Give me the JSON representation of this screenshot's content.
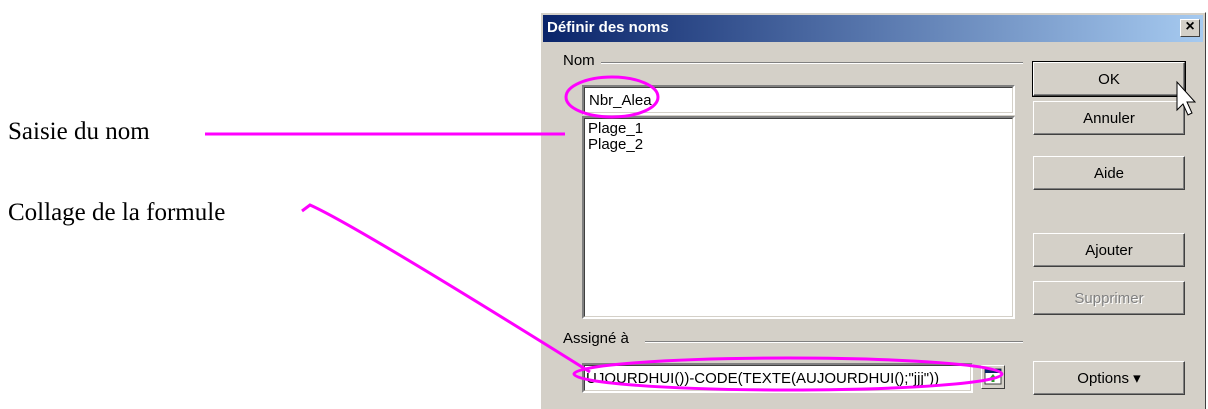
{
  "annotations": {
    "name_input": "Saisie du nom",
    "formula_paste": "Collage de la formule"
  },
  "dialog": {
    "title": "Définir des noms",
    "close_label": "×",
    "name_group_label": "Nom",
    "name_value": "Nbr_Alea",
    "names_list": [
      "Plage_1",
      "Plage_2"
    ],
    "assigned_group_label": "Assigné à",
    "assigned_value": "UJOURDHUI())-CODE(TEXTE(AUJOURDHUI();\"jjj\"))",
    "buttons": {
      "ok": "OK",
      "cancel": "Annuler",
      "help": "Aide",
      "add": "Ajouter",
      "delete": "Supprimer",
      "options": "Options ▾"
    }
  },
  "colors": {
    "highlight": "#ff00ff",
    "titlebar_start": "#0a246a",
    "titlebar_end": "#a6caf0"
  },
  "icons": {
    "collapse_button": "shrink-dialog-icon",
    "cursor": "mouse-pointer-icon"
  }
}
